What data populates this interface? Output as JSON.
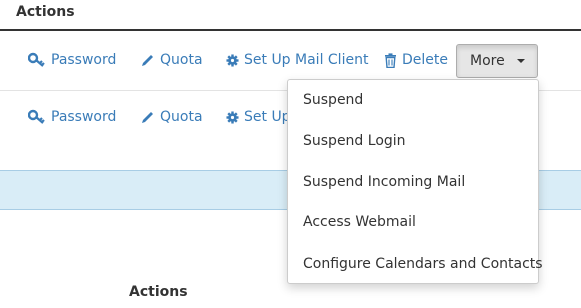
{
  "header": {
    "title": "Actions"
  },
  "row1": {
    "password_label": "Password",
    "quota_label": "Quota",
    "setup_label": "Set Up Mail Client",
    "delete_label": "Delete",
    "more_label": "More"
  },
  "row2": {
    "password_label": "Password",
    "quota_label": "Quota",
    "setup_label": "Set Up"
  },
  "dropdown": {
    "items": [
      {
        "label": "Suspend"
      },
      {
        "label": "Suspend Login"
      },
      {
        "label": "Suspend Incoming Mail"
      },
      {
        "label": "Access Webmail"
      },
      {
        "label": "Configure Calendars and Contacts"
      }
    ]
  },
  "footer": {
    "actions_label": "Actions"
  },
  "colors": {
    "link": "#3a7cb8",
    "highlight_row": "#d9edf7",
    "text": "#333333"
  },
  "icons": [
    "key-icon",
    "pencil-icon",
    "gear-icon",
    "trash-icon",
    "caret-down-icon"
  ]
}
